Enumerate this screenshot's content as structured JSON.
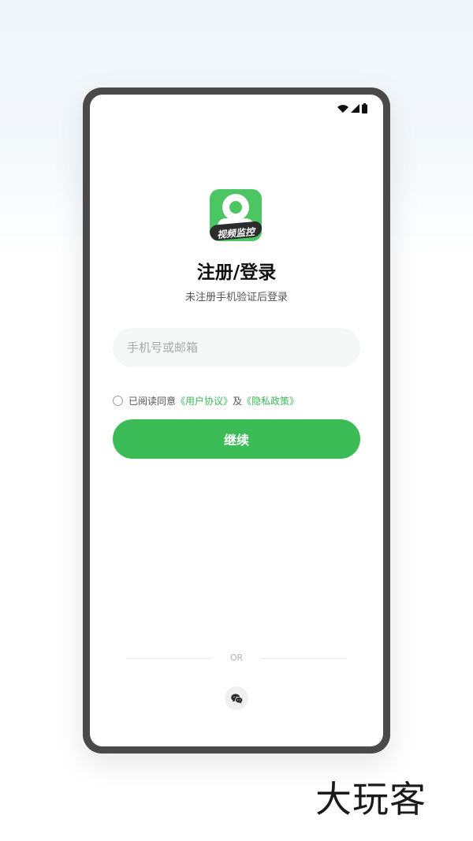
{
  "status_bar": {
    "icons": [
      "wifi-icon",
      "cellular-signal-icon",
      "battery-icon"
    ]
  },
  "app": {
    "logo_text": "视频监控",
    "brand_color": "#3cbc57"
  },
  "login": {
    "title": "注册/登录",
    "subtitle": "未注册手机验证后登录",
    "input_placeholder": "手机号或邮箱",
    "input_value": "",
    "agreement_prefix": "已阅读同意",
    "user_agreement_link": "《用户协议》",
    "agreement_and": "及",
    "privacy_policy_link": "《隐私政策》",
    "agreement_checked": false,
    "continue_label": "继续"
  },
  "alt_login": {
    "divider_text": "OR",
    "wechat_icon": "wechat-icon"
  },
  "watermark": {
    "text": "大玩客"
  }
}
